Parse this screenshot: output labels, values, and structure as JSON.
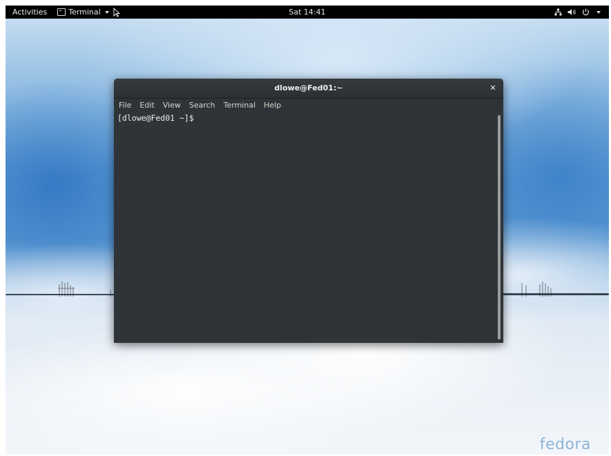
{
  "top_bar": {
    "activities_label": "Activities",
    "app_menu_label": "Terminal",
    "app_icon": "terminal-icon",
    "clock": "Sat 14:41",
    "tray_icons": [
      "network-wired-icon",
      "volume-icon",
      "power-icon",
      "chevron-down-icon"
    ]
  },
  "terminal_window": {
    "title": "dlowe@Fed01:~",
    "close_icon": "close-icon",
    "menu": {
      "file": "File",
      "edit": "Edit",
      "view": "View",
      "search": "Search",
      "terminal": "Terminal",
      "help": "Help"
    },
    "prompt": "[dlowe@Fed01 ~]$",
    "background_color": "#2e3436",
    "text_color": "#eeeeec"
  },
  "desktop": {
    "watermark": "fedora",
    "watermark_color": "#8fb4d8"
  }
}
